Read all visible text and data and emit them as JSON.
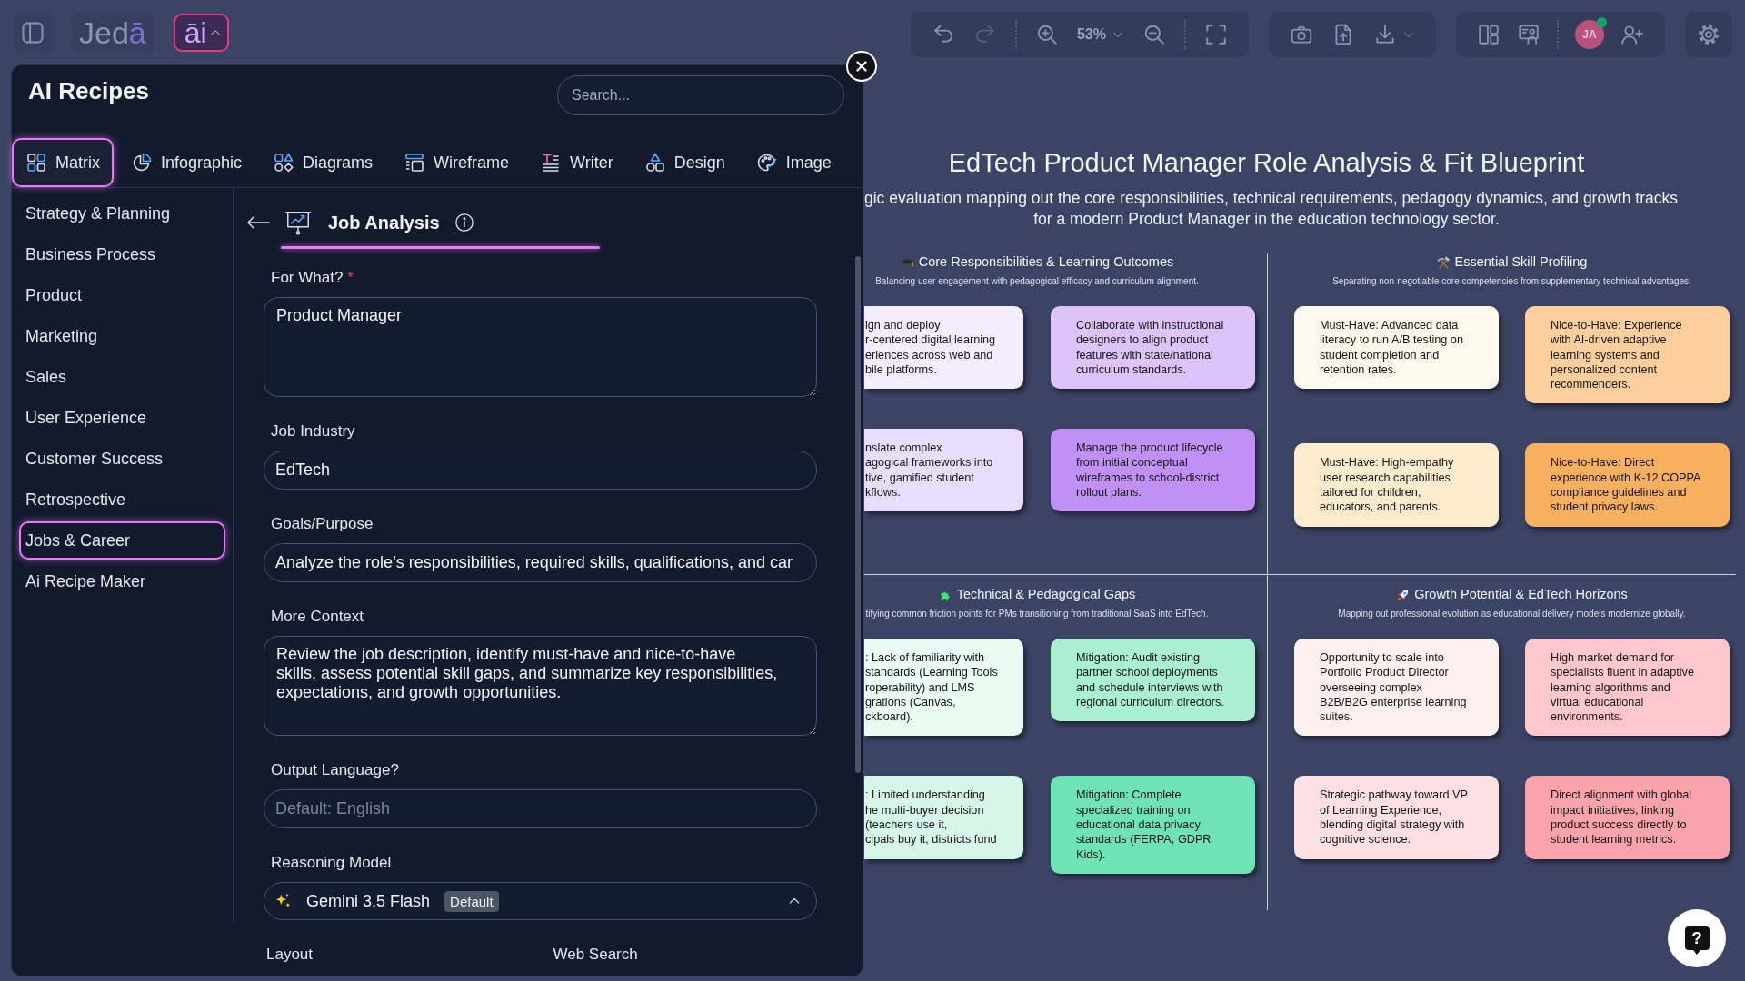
{
  "top_bar": {
    "logo": "Jedā",
    "ai_button": {
      "label": "āi",
      "expanded": true
    }
  },
  "toolbar": {
    "undo": {
      "disabled": false
    },
    "redo": {
      "disabled": true
    },
    "zoom": "53%",
    "avatar": {
      "initials": "JA",
      "online": true
    }
  },
  "recipes_panel": {
    "title": "AI Recipes",
    "search": {
      "placeholder": "Search..."
    },
    "tabs": [
      {
        "label": "Matrix",
        "selected": true
      },
      {
        "label": "Infographic",
        "selected": false
      },
      {
        "label": "Diagrams",
        "selected": false
      },
      {
        "label": "Wireframe",
        "selected": false
      },
      {
        "label": "Writer",
        "selected": false
      },
      {
        "label": "Design",
        "selected": false
      },
      {
        "label": "Image",
        "selected": false
      }
    ],
    "categories": [
      {
        "label": "Strategy & Planning",
        "selected": false
      },
      {
        "label": "Business Process",
        "selected": false
      },
      {
        "label": "Product",
        "selected": false
      },
      {
        "label": "Marketing",
        "selected": false
      },
      {
        "label": "Sales",
        "selected": false
      },
      {
        "label": "User Experience",
        "selected": false
      },
      {
        "label": "Customer Success",
        "selected": false
      },
      {
        "label": "Retrospective",
        "selected": false
      },
      {
        "label": "Jobs & Career",
        "selected": true
      },
      {
        "label": "Ai Recipe Maker",
        "selected": false
      }
    ],
    "recipe": {
      "title": "Job Analysis"
    },
    "fields": [
      {
        "kind": "textarea",
        "label": "For What?",
        "required_mark": "*",
        "value": "Product Manager"
      },
      {
        "kind": "input",
        "label": "Job Industry",
        "value": "EdTech"
      },
      {
        "kind": "input",
        "label": "Goals/Purpose",
        "value": "Analyze the role’s responsibilities, required skills, qualifications, and car"
      },
      {
        "kind": "textarea",
        "label": "More Context",
        "value": "Review the job description, identify must-have and nice-to-have skills, assess potential skill gaps, and summarize key responsibilities, expectations, and growth opportunities."
      },
      {
        "kind": "input",
        "label": "Output Language?",
        "placeholder": "Default: English"
      },
      {
        "kind": "select",
        "label": "Reasoning Model",
        "value": "Gemini 3.5 Flash",
        "badge": "Default"
      }
    ],
    "more_fields": [
      "Layout",
      "Web Search"
    ]
  },
  "canvas": {
    "title": "EdTech Product Manager Role Analysis & Fit Blueprint",
    "subtitle": [
      "gic evaluation mapping out the core responsibilities, technical requirements, pedagogy dynamics, and growth tracks",
      "for a modern Product Manager in the education technology sector."
    ],
    "sections": [
      {
        "title": "Core Responsibilities & Learning Outcomes",
        "subtitle": "Balancing user engagement with pedagogical efficacy and curriculum alignment.",
        "cards": [
          {
            "kind": "partial",
            "color": "#f5edfe",
            "lines": [
              "ign and deploy",
              "r-centered digital learning",
              "eriences across web and",
              "bile platforms."
            ]
          },
          {
            "kind": "full",
            "color": "#dcc4fb",
            "text": "Collaborate with instructional designers to align product features with state/national curriculum standards."
          },
          {
            "kind": "partial",
            "color": "#eadcfd",
            "lines": [
              "nslate complex",
              "agogical frameworks into",
              "tive, gamified student",
              "kflows."
            ]
          },
          {
            "kind": "full",
            "color": "#c190f5",
            "text": "Manage the product lifecycle from initial conceptual wireframes to school-district rollout plans."
          }
        ]
      },
      {
        "title": "Essential Skill Profiling",
        "subtitle": "Separating non-negotiable core competencies from supplementary technical advantages.",
        "cards": [
          {
            "kind": "full",
            "color": "#fff8ec",
            "text": "Must-Have: Advanced data literacy to run A/B testing on student completion and retention rates."
          },
          {
            "kind": "full",
            "color": "#fccf9d",
            "text": "Nice-to-Have: Experience with AI-driven adaptive learning systems and personalized content recommenders."
          },
          {
            "kind": "full",
            "color": "#feeacd",
            "text": "Must-Have: High-empathy user research capabilities tailored for children, educators, and parents."
          },
          {
            "kind": "full",
            "color": "#f8af60",
            "text": "Nice-to-Have: Direct experience with K-12 COPPA compliance guidelines and student privacy laws."
          }
        ]
      },
      {
        "title": "Technical & Pedagogical Gaps",
        "subtitle": "tifying common friction points for PMs transitioning from traditional SaaS into EdTech.",
        "cards": [
          {
            "kind": "partial",
            "color": "#eafbf3",
            "lines": [
              ": Lack of familiarity with",
              "standards (Learning Tools",
              "roperability) and LMS",
              "grations (Canvas,",
              "ckboard)."
            ]
          },
          {
            "kind": "full",
            "color": "#a9efd0",
            "text": "Mitigation: Audit existing partner school deployments and schedule interviews with regional curriculum directors."
          },
          {
            "kind": "partial",
            "color": "#d6f7e7",
            "lines": [
              ": Limited understanding",
              "he multi-buyer decision",
              "(teachers use it,",
              "cipals buy it, districts fund"
            ]
          },
          {
            "kind": "full",
            "color": "#70e3b6",
            "text": "Mitigation: Complete specialized training on educational data privacy standards (FERPA, GDPR Kids)."
          }
        ]
      },
      {
        "title": "Growth Potential & EdTech Horizons",
        "subtitle": "Mapping out professional evolution as educational delivery models modernize globally.",
        "cards": [
          {
            "kind": "full",
            "color": "#fff0f0",
            "text": "Opportunity to scale into Portfolio Product Director overseeing complex B2B/B2G enterprise learning suites."
          },
          {
            "kind": "full",
            "color": "#fec7cc",
            "text": "High market demand for specialists fluent in adaptive learning algorithms and virtual educational environments."
          },
          {
            "kind": "full",
            "color": "#fde0e3",
            "text": "Strategic pathway toward VP of Learning Experience, blending digital strategy with cognitive science."
          },
          {
            "kind": "full",
            "color": "#fba3ad",
            "text": "Direct alignment with global impact initiatives, linking product success directly to student learning metrics."
          }
        ]
      }
    ]
  },
  "help_button": {
    "label": "?"
  }
}
